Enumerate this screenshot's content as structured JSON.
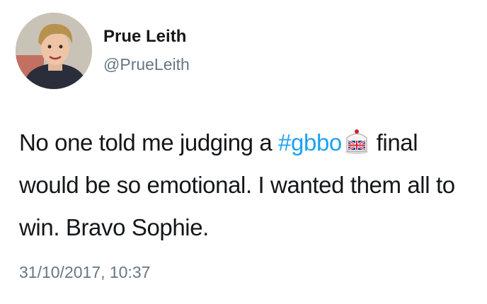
{
  "author": {
    "display_name": "Prue Leith",
    "handle": "@PrueLeith"
  },
  "tweet": {
    "text_before_hashtag": "No one told me judging a ",
    "hashtag": "#gbbo",
    "text_after_emoji": " final would be so emotional. I wanted them all to win. Bravo Sophie.",
    "emoji_icon": "cake-union-jack-icon",
    "timestamp": "31/10/2017, 10:37"
  },
  "colors": {
    "hashtag": "#1da1f2",
    "secondary_text": "#657786",
    "primary_text": "#14171a"
  }
}
